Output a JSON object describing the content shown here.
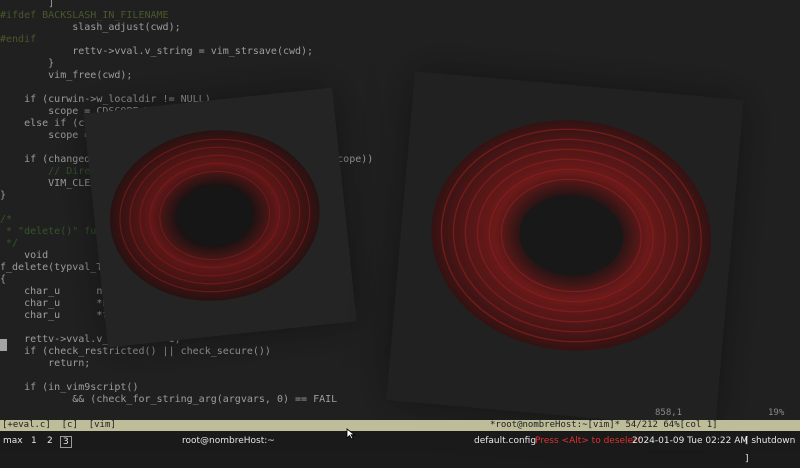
{
  "editor": {
    "lines": [
      {
        "segments": [
          {
            "t": "        ]",
            "c": "code"
          }
        ]
      },
      {
        "segments": [
          {
            "t": "#ifdef BACKSLASH_IN_FILENAME",
            "c": "macro"
          }
        ]
      },
      {
        "segments": [
          {
            "t": "            slash_adjust(cwd);",
            "c": "code"
          }
        ]
      },
      {
        "segments": [
          {
            "t": "#endif",
            "c": "macro"
          }
        ]
      },
      {
        "segments": [
          {
            "t": "            rettv->vval.v_string = vim_strsave(cwd);",
            "c": "code"
          }
        ]
      },
      {
        "segments": [
          {
            "t": "        }",
            "c": "code"
          }
        ]
      },
      {
        "segments": [
          {
            "t": "        vim_free(cwd);",
            "c": "code"
          }
        ]
      },
      {
        "segments": [
          {
            "t": "",
            "c": "code"
          }
        ]
      },
      {
        "segments": [
          {
            "t": "    if (curwin->w_localdir != NULL)",
            "c": "code"
          }
        ]
      },
      {
        "segments": [
          {
            "t": "        scope = CDSCOPE_WINDOW;",
            "c": "code"
          }
        ]
      },
      {
        "segments": [
          {
            "t": "    else if (curtab->tp_localdir != NULL)",
            "c": "code"
          }
        ]
      },
      {
        "segments": [
          {
            "t": "        scope = CDSCOPE_TABPAGE;",
            "c": "code"
          }
        ]
      },
      {
        "segments": [
          {
            "t": "",
            "c": "code"
          }
        ]
      },
      {
        "segments": [
          {
            "t": "    if (changedir_func(argvars[0].vval.v_string, TRUE, scope))",
            "c": "code"
          }
        ]
      },
      {
        "segments": [
          {
            "t": "        // Directory change failed",
            "c": "comment"
          }
        ]
      },
      {
        "segments": [
          {
            "t": "        VIM_CLEAR(rettv->vval.v_string);",
            "c": "code"
          }
        ]
      },
      {
        "segments": [
          {
            "t": "}",
            "c": "code"
          }
        ]
      },
      {
        "segments": [
          {
            "t": "",
            "c": "code"
          }
        ]
      },
      {
        "segments": [
          {
            "t": "/*",
            "c": "comment"
          }
        ]
      },
      {
        "segments": [
          {
            "t": " * \"delete()\" function",
            "c": "comment"
          }
        ]
      },
      {
        "segments": [
          {
            "t": " */",
            "c": "comment"
          }
        ]
      },
      {
        "segments": [
          {
            "t": "    void",
            "c": "code"
          }
        ]
      },
      {
        "segments": [
          {
            "t": "f_delete(typval_T *argvars, typval_T *rettv)",
            "c": "code"
          }
        ]
      },
      {
        "segments": [
          {
            "t": "{",
            "c": "code"
          }
        ]
      },
      {
        "segments": [
          {
            "t": "    char_u      nbuf[NUMBUFLEN];",
            "c": "code"
          }
        ]
      },
      {
        "segments": [
          {
            "t": "    char_u      *name;",
            "c": "code"
          }
        ]
      },
      {
        "segments": [
          {
            "t": "    char_u      *flags;",
            "c": "code"
          }
        ]
      },
      {
        "segments": [
          {
            "t": "",
            "c": "code"
          }
        ]
      },
      {
        "segments": [
          {
            "t": "    rettv->vval.v_number = -1;",
            "c": "code"
          }
        ]
      },
      {
        "segments": [
          {
            "t": "    if (check_restricted() || check_secure())",
            "c": "code"
          }
        ]
      },
      {
        "segments": [
          {
            "t": "        return;",
            "c": "code"
          }
        ]
      },
      {
        "segments": [
          {
            "t": "",
            "c": "code"
          }
        ]
      },
      {
        "segments": [
          {
            "t": "    if (in_vim9script()",
            "c": "code"
          }
        ]
      },
      {
        "segments": [
          {
            "t": "            && (check_for_string_arg(argvars, 0) == FAIL",
            "c": "code"
          }
        ]
      }
    ]
  },
  "vim": {
    "status_left": "[+eval.c]  [c]  [vim]",
    "status_mid": "*root@nombreHost:~[vim]* 54/212 64%[col 1]",
    "ruler": "858,1",
    "ruler_pct": "19%"
  },
  "taskbar": {
    "layout": "max",
    "ws1": "1",
    "ws2": "2",
    "ws3": "3",
    "window_title": "root@nombreHost:~",
    "config": "default.config",
    "hint": "Press <Alt> to deselect",
    "datetime": "2024-01-09 Tue 02:22 AM",
    "shutdown": "[ shutdown ]"
  },
  "colors": {
    "disc_red": "#8a1414",
    "sleeve_dark": "#1f1f1f",
    "status_bar": "#bdbd9a"
  },
  "icons": {
    "mouse": "arrow-pointer-icon"
  }
}
